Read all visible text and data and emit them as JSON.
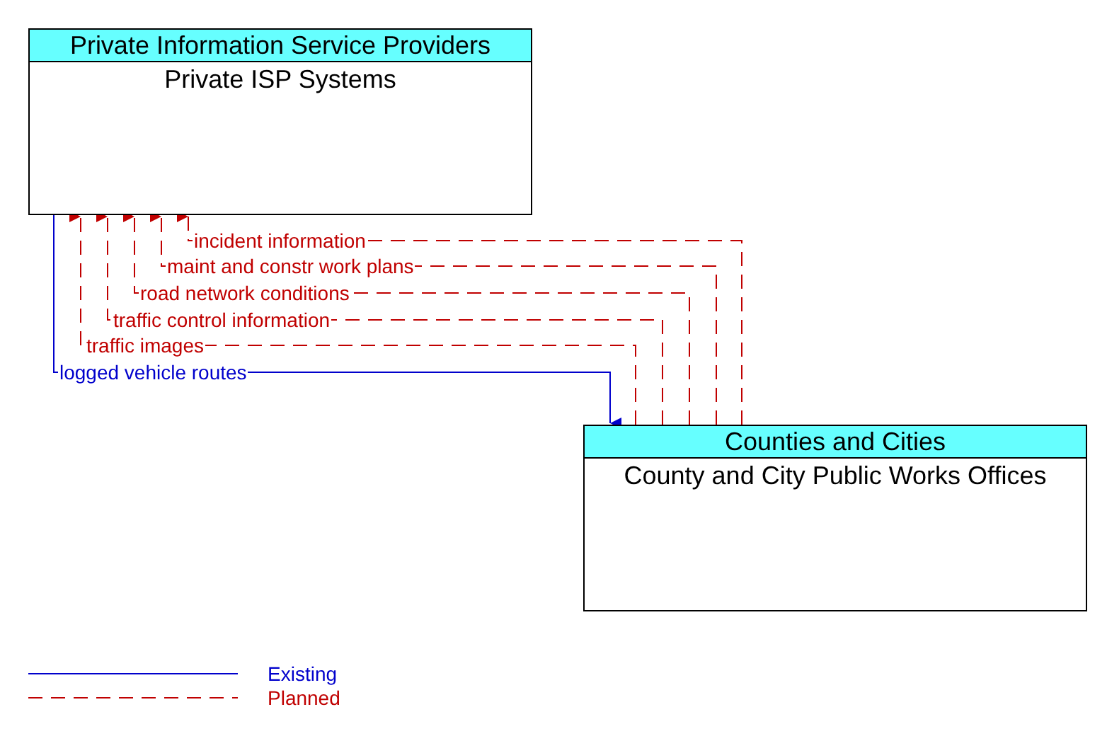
{
  "nodes": [
    {
      "group": "Private Information Service Providers",
      "name": "Private ISP Systems"
    },
    {
      "group": "Counties and Cities",
      "name": "County and City Public Works Offices"
    }
  ],
  "flows": [
    {
      "label": "incident information",
      "kind": "planned",
      "toward_second": false
    },
    {
      "label": "maint and constr work plans",
      "kind": "planned",
      "toward_second": false
    },
    {
      "label": "road network conditions",
      "kind": "planned",
      "toward_second": false
    },
    {
      "label": "traffic control information",
      "kind": "planned",
      "toward_second": false
    },
    {
      "label": "traffic images",
      "kind": "planned",
      "toward_second": false
    },
    {
      "label": "logged vehicle routes",
      "kind": "existing",
      "toward_second": true
    }
  ],
  "legend": [
    {
      "label": "Existing",
      "kind": "existing"
    },
    {
      "label": "Planned",
      "kind": "planned"
    }
  ]
}
